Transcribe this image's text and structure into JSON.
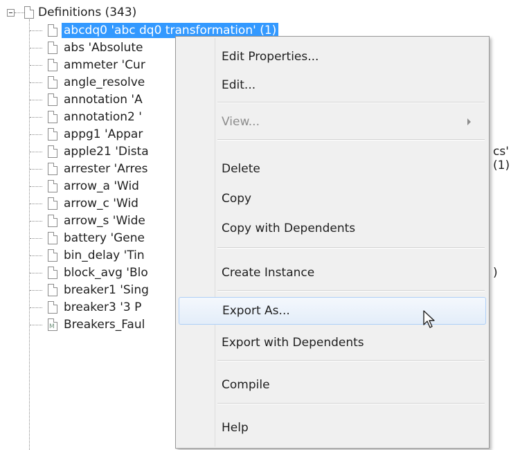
{
  "tree": {
    "root": {
      "label": "Definitions (343)"
    },
    "items": [
      {
        "label": "abcdq0 'abc dq0 transformation' (1)",
        "selected": true,
        "icon": "document-icon"
      },
      {
        "label": "abs 'Absolute",
        "icon": "document-icon"
      },
      {
        "label": "ammeter 'Cur",
        "icon": "document-icon"
      },
      {
        "label": "angle_resolve",
        "icon": "document-icon"
      },
      {
        "label": "annotation 'A",
        "icon": "document-icon"
      },
      {
        "label": "annotation2 '",
        "icon": "document-icon"
      },
      {
        "label": "appg1 'Appar",
        "icon": "document-icon"
      },
      {
        "label": "apple21 'Dista",
        "icon": "document-icon",
        "tail": "cs' (1)"
      },
      {
        "label": "arrester 'Arres",
        "icon": "document-icon"
      },
      {
        "label": "arrow_a 'Wid",
        "icon": "document-icon"
      },
      {
        "label": "arrow_c 'Wid",
        "icon": "document-icon"
      },
      {
        "label": "arrow_s 'Wide",
        "icon": "document-icon"
      },
      {
        "label": "battery 'Gene",
        "icon": "document-icon"
      },
      {
        "label": "bin_delay 'Tin",
        "icon": "document-icon"
      },
      {
        "label": "block_avg 'Blo",
        "icon": "document-icon",
        "tail": ")"
      },
      {
        "label": "breaker1 'Sing",
        "icon": "document-icon"
      },
      {
        "label": "breaker3 '3 P",
        "icon": "document-icon"
      },
      {
        "label": "Breakers_Faul",
        "icon": "module-icon"
      }
    ]
  },
  "context_menu": {
    "items": [
      {
        "label": "Edit Properties...",
        "enabled": true
      },
      {
        "label": "Edit...",
        "enabled": true
      },
      {
        "label": "View...",
        "enabled": false,
        "submenu": true
      },
      {
        "label": "Delete",
        "enabled": true
      },
      {
        "label": "Copy",
        "enabled": true
      },
      {
        "label": "Copy with Dependents",
        "enabled": true
      },
      {
        "label": "Create Instance",
        "enabled": true
      },
      {
        "label": "Export As...",
        "enabled": true,
        "hovered": true
      },
      {
        "label": "Export with Dependents",
        "enabled": true
      },
      {
        "label": "Compile",
        "enabled": true
      },
      {
        "label": "Help",
        "enabled": true
      }
    ]
  },
  "colors": {
    "selection": "#3399ff",
    "menu_background": "#f0f0f0",
    "hover_border": "#aecff7",
    "disabled_text": "#8d8d8d"
  }
}
